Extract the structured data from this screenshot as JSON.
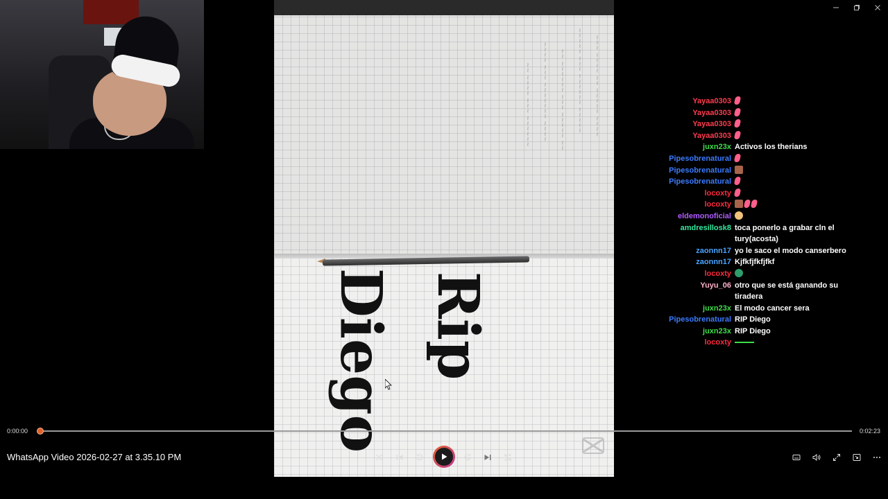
{
  "window": {
    "minimize_icon": "minimize-icon",
    "maximize_icon": "restore-icon",
    "close_icon": "close-icon"
  },
  "video": {
    "overlay_text_1": "Rip",
    "overlay_text_2": "Diego",
    "watermark_icon": "capcut-logo-icon"
  },
  "chat": {
    "messages": [
      {
        "user": "Yayaa0303",
        "color": "#ff3b4e",
        "text": "",
        "emotes": [
          "pink"
        ]
      },
      {
        "user": "Yayaa0303",
        "color": "#ff3b4e",
        "text": "",
        "emotes": [
          "pink"
        ]
      },
      {
        "user": "Yayaa0303",
        "color": "#ff3b4e",
        "text": "",
        "emotes": [
          "pink"
        ]
      },
      {
        "user": "Yayaa0303",
        "color": "#ff3b4e",
        "text": "",
        "emotes": [
          "pink"
        ]
      },
      {
        "user": "juxn23x",
        "color": "#3fdd4b",
        "text": "Activos los therians",
        "emotes": []
      },
      {
        "user": "Pipesobrenatural",
        "color": "#3b7bff",
        "text": "",
        "emotes": [
          "pink"
        ]
      },
      {
        "user": "Pipesobrenatural",
        "color": "#3b7bff",
        "text": "",
        "emotes": [
          "face"
        ]
      },
      {
        "user": "Pipesobrenatural",
        "color": "#3b7bff",
        "text": "",
        "emotes": [
          "pink"
        ]
      },
      {
        "user": "locoxty",
        "color": "#ff2a3d",
        "text": "",
        "emotes": [
          "pink"
        ]
      },
      {
        "user": "locoxty",
        "color": "#ff2a3d",
        "text": "",
        "emotes": [
          "face",
          "pink",
          "pink"
        ]
      },
      {
        "user": "eldemonoficial",
        "color": "#b05cff",
        "text": "",
        "emotes": [
          "cat"
        ]
      },
      {
        "user": "amdresillosk8",
        "color": "#34e8a0",
        "text": "toca ponerlo a grabar cln el tury(acosta)",
        "emotes": []
      },
      {
        "user": "zaonnn17",
        "color": "#4aa3ff",
        "text": "yo le saco el modo canserbero",
        "emotes": []
      },
      {
        "user": "zaonnn17",
        "color": "#4aa3ff",
        "text": "Kjfkfjfkfjfkf",
        "emotes": []
      },
      {
        "user": "locoxty",
        "color": "#ff2a3d",
        "text": "",
        "emotes": [
          "ball"
        ]
      },
      {
        "user": "Yuyu_06",
        "color": "#ffb0c8",
        "text": "otro que se está ganando su tiradera",
        "emotes": []
      },
      {
        "user": "juxn23x",
        "color": "#3fdd4b",
        "text": "El modo cancer sera",
        "emotes": []
      },
      {
        "user": "Pipesobrenatural",
        "color": "#3b7bff",
        "text": "RIP Diego",
        "emotes": []
      },
      {
        "user": "juxn23x",
        "color": "#3fdd4b",
        "text": "RIP Diego",
        "emotes": []
      },
      {
        "user": "locoxty",
        "color": "#ff2a3d",
        "text": "",
        "emotes": [
          "line"
        ]
      }
    ]
  },
  "player": {
    "current_time": "0:00:00",
    "total_time": "0:02:23",
    "progress": 0.0,
    "title": "WhatsApp Video 2026-02-27 at 3.35.10 PM",
    "accent": "#e0622d",
    "controls": [
      {
        "name": "shuffle-button",
        "icon": "shuffle-icon"
      },
      {
        "name": "previous-button",
        "icon": "previous-icon"
      },
      {
        "name": "rewind-10-button",
        "icon": "rewind-10-icon"
      },
      {
        "name": "play-button",
        "icon": "play-icon"
      },
      {
        "name": "forward-30-button",
        "icon": "forward-30-icon"
      },
      {
        "name": "next-button",
        "icon": "next-icon"
      },
      {
        "name": "repeat-off-button",
        "icon": "repeat-off-icon"
      }
    ],
    "right_controls": [
      {
        "name": "captions-button",
        "icon": "captions-icon"
      },
      {
        "name": "volume-button",
        "icon": "volume-icon"
      },
      {
        "name": "fullscreen-button",
        "icon": "fullscreen-icon"
      },
      {
        "name": "miniplayer-button",
        "icon": "miniplayer-icon"
      },
      {
        "name": "more-options-button",
        "icon": "more-icon"
      }
    ]
  }
}
